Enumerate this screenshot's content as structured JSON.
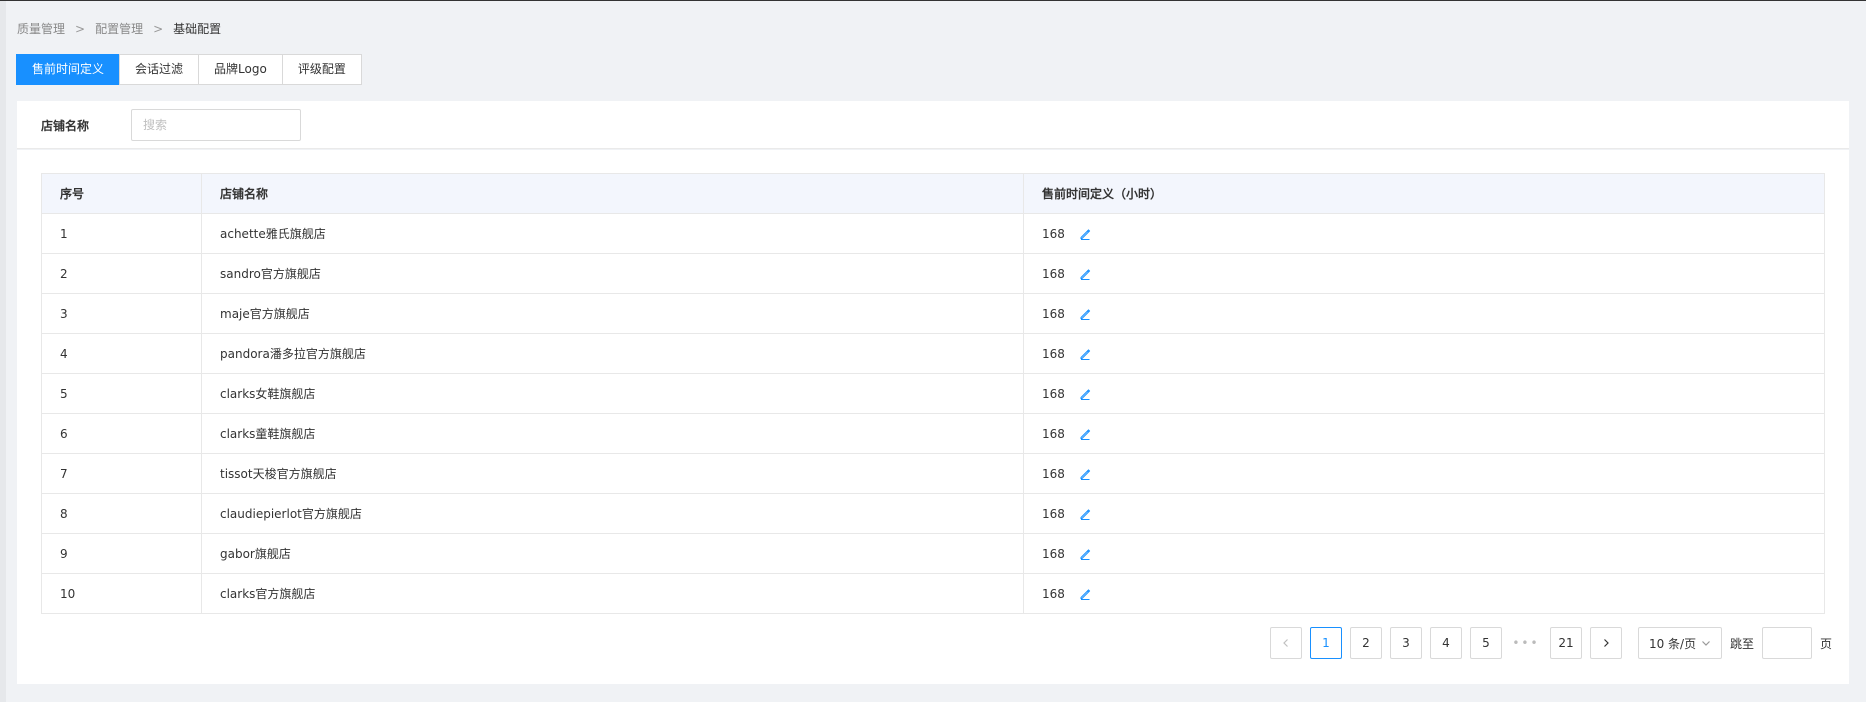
{
  "breadcrumb": [
    "质量管理",
    "配置管理",
    "基础配置"
  ],
  "breadcrumb_sep": ">",
  "tabs": [
    {
      "label": "售前时间定义",
      "active": true
    },
    {
      "label": "会话过滤",
      "active": false
    },
    {
      "label": "品牌Logo",
      "active": false
    },
    {
      "label": "评级配置",
      "active": false
    }
  ],
  "filter": {
    "label": "店铺名称",
    "placeholder": "搜索",
    "value": ""
  },
  "table": {
    "headers": [
      "序号",
      "店铺名称",
      "售前时间定义（小时）"
    ],
    "rows": [
      {
        "idx": "1",
        "shop": "achette雅氏旗舰店",
        "hours": "168"
      },
      {
        "idx": "2",
        "shop": "sandro官方旗舰店",
        "hours": "168"
      },
      {
        "idx": "3",
        "shop": "maje官方旗舰店",
        "hours": "168"
      },
      {
        "idx": "4",
        "shop": "pandora潘多拉官方旗舰店",
        "hours": "168"
      },
      {
        "idx": "5",
        "shop": "clarks女鞋旗舰店",
        "hours": "168"
      },
      {
        "idx": "6",
        "shop": "clarks童鞋旗舰店",
        "hours": "168"
      },
      {
        "idx": "7",
        "shop": "tissot天梭官方旗舰店",
        "hours": "168"
      },
      {
        "idx": "8",
        "shop": "claudiepierlot官方旗舰店",
        "hours": "168"
      },
      {
        "idx": "9",
        "shop": "gabor旗舰店",
        "hours": "168"
      },
      {
        "idx": "10",
        "shop": "clarks官方旗舰店",
        "hours": "168"
      }
    ]
  },
  "pagination": {
    "pages": [
      "1",
      "2",
      "3",
      "4",
      "5"
    ],
    "ellipsis": "•••",
    "last_page": "21",
    "current": "1",
    "page_size": "10 条/页",
    "jump_label": "跳至",
    "jump_value": "",
    "page_suffix": "页"
  },
  "colors": {
    "accent": "#1890ff",
    "header_bg": "#f3f6fd",
    "page_bg": "#f0f2f5"
  },
  "icons": {
    "edit": "pencil-edit-icon",
    "prev": "chevron-left-icon",
    "next": "chevron-right-icon",
    "dropdown": "chevron-down-icon"
  }
}
